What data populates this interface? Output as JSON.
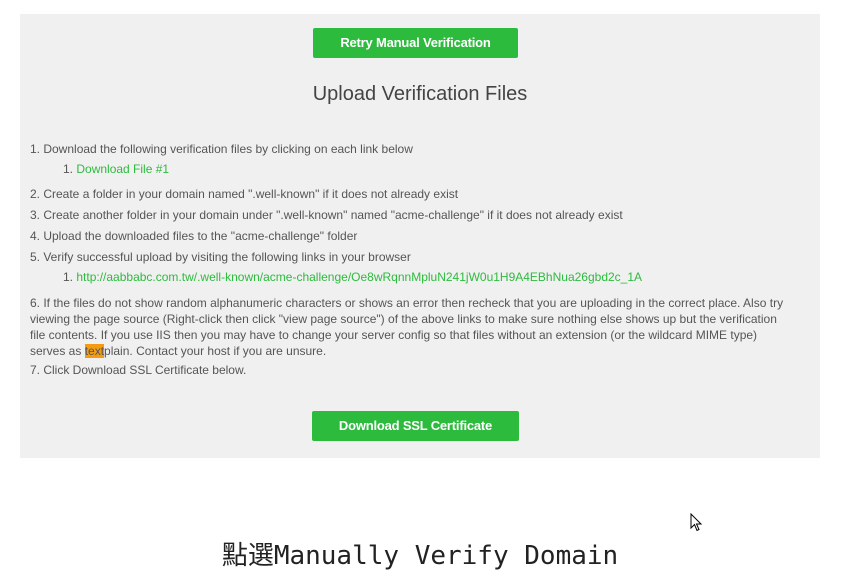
{
  "buttons": {
    "retry_label": "Retry Manual Verification",
    "download_label": "Download SSL Certificate"
  },
  "heading": "Upload Verification Files",
  "steps": {
    "s1": "1. Download the following verification files by clicking on each link below",
    "s1_sub": "1.",
    "s1_link": "Download File #1",
    "s2": "2. Create a folder in your domain named \".well-known\" if it does not already exist",
    "s3": "3. Create another folder in your domain under \".well-known\" named \"acme-challenge\" if it does not already exist",
    "s4": "4. Upload the downloaded files to the \"acme-challenge\" folder",
    "s5": "5. Verify successful upload by visiting the following links in your browser",
    "s5_sub": "1.",
    "s5_link": "http://aabbabc.com.tw/.well-known/acme-challenge/Oe8wRqnnMpluN241jW0u1H9A4EBhNua26gbd2c_1A",
    "s6_a": "6. If the files do not show random alphanumeric characters or shows an error then recheck that you are uploading in the correct place. Also try viewing the page source (Right-click then click \"view page source\") of the above links to make sure nothing else shows up but the verification file contents. If you use IIS then you may have to change your server config so that files without an extension (or the wildcard MIME type) serves as",
    "s6_hl": "text",
    "s6_b": "plain. Contact your host if you are unsure.",
    "s7": "7. Click Download SSL Certificate below."
  },
  "caption": "點選Manually Verify Domain",
  "icons": [
    "cursor-arrow-icon"
  ],
  "colors": {
    "accent": "#2dbb3e",
    "highlight": "#f39c12",
    "panel": "#f0f0f0"
  }
}
